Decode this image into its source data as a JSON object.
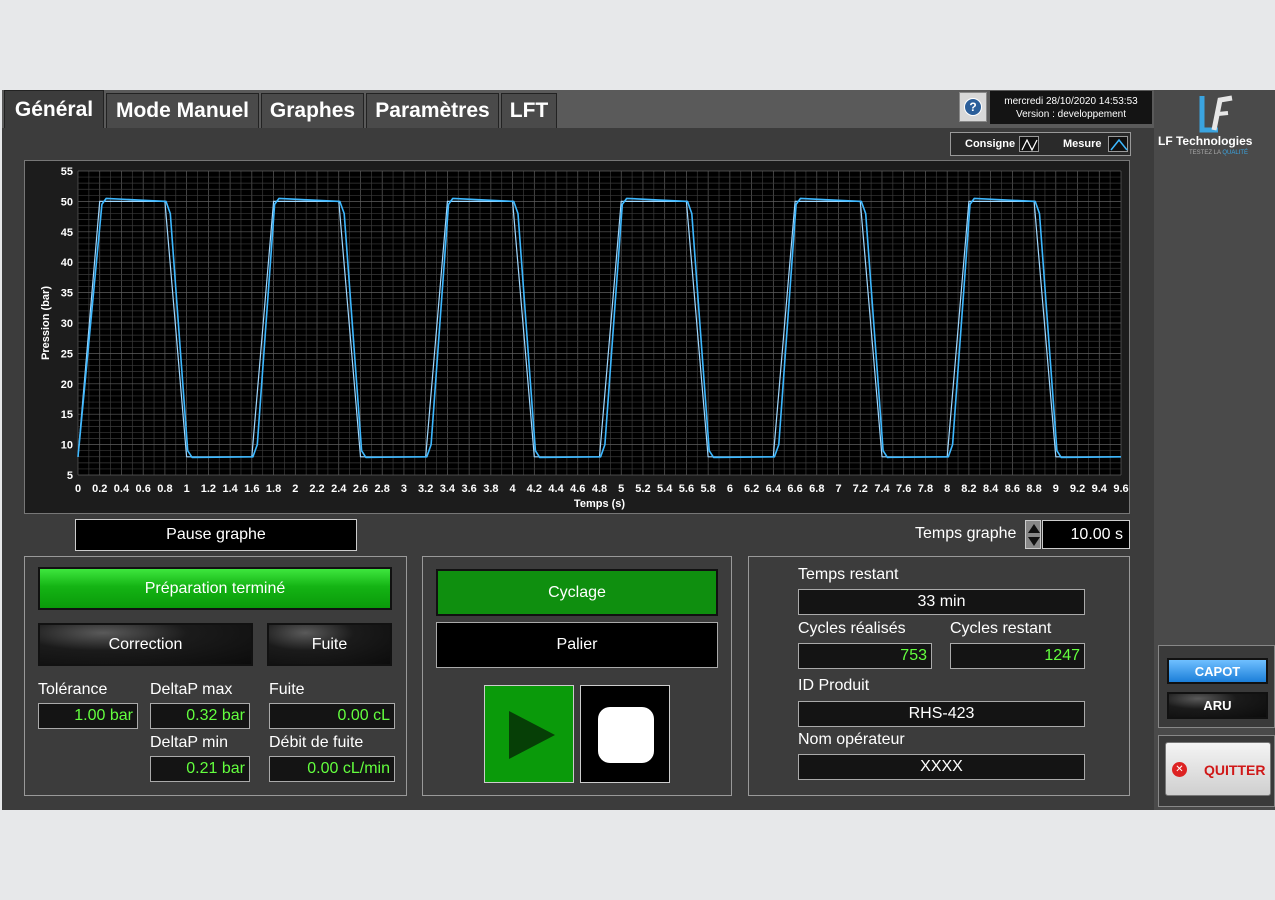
{
  "tabs": [
    {
      "label": "Général",
      "active": true
    },
    {
      "label": "Mode Manuel",
      "active": false
    },
    {
      "label": "Graphes",
      "active": false
    },
    {
      "label": "Paramètres",
      "active": false
    },
    {
      "label": "LFT",
      "active": false
    }
  ],
  "header": {
    "date": "mercredi 28/10/2020 14:53:53",
    "version": "Version : developpement",
    "help_icon": "question-icon"
  },
  "logo": {
    "brand": "LF Technologies",
    "tagline_prefix": "TESTEZ LA ",
    "tagline_highlight": "QUALITÉ"
  },
  "legend": {
    "consigne": "Consigne",
    "mesure": "Mesure"
  },
  "chart_data": {
    "type": "line",
    "xlabel": "Temps (s)",
    "ylabel": "Pression (bar)",
    "xlim": [
      0,
      9.6
    ],
    "ylim": [
      5,
      55
    ],
    "x_ticks": [
      0,
      0.2,
      0.4,
      0.6,
      0.8,
      1,
      1.2,
      1.4,
      1.6,
      1.8,
      2,
      2.2,
      2.4,
      2.6,
      2.8,
      3,
      3.2,
      3.4,
      3.6,
      3.8,
      4,
      4.2,
      4.4,
      4.6,
      4.8,
      5,
      5.2,
      5.4,
      5.6,
      5.8,
      6,
      6.2,
      6.4,
      6.6,
      6.8,
      7,
      7.2,
      7.4,
      7.6,
      7.8,
      8,
      8.2,
      8.4,
      8.6,
      8.8,
      9,
      9.2,
      9.4,
      9.6
    ],
    "y_ticks": [
      5,
      10,
      15,
      20,
      25,
      30,
      35,
      40,
      45,
      50,
      55
    ],
    "grid": true,
    "legend_position": "top-right",
    "series": [
      {
        "name": "Consigne",
        "color": "#9fd8ff",
        "x": [
          0,
          0.2,
          0.8,
          1.0,
          1.6,
          1.8,
          2.4,
          2.6,
          3.2,
          3.4,
          4.0,
          4.2,
          4.8,
          5.0,
          5.6,
          5.8,
          6.4,
          6.6,
          7.2,
          7.4,
          8.0,
          8.2,
          8.8,
          9.0,
          9.6
        ],
        "y": [
          8,
          50,
          50,
          8,
          8,
          50,
          50,
          8,
          8,
          50,
          50,
          8,
          8,
          50,
          50,
          8,
          8,
          50,
          50,
          8,
          8,
          50,
          50,
          8,
          8
        ]
      },
      {
        "name": "Mesure",
        "color": "#3db8ff",
        "x": [
          0,
          0.22,
          0.26,
          0.81,
          0.85,
          1.01,
          1.05,
          1.61,
          1.65,
          1.81,
          1.85,
          2.41,
          2.45,
          2.61,
          2.65,
          3.21,
          3.25,
          3.41,
          3.45,
          4.01,
          4.05,
          4.21,
          4.25,
          4.81,
          4.85,
          5.01,
          5.05,
          5.61,
          5.65,
          5.81,
          5.85,
          6.41,
          6.45,
          6.61,
          6.65,
          7.21,
          7.25,
          7.41,
          7.45,
          8.01,
          8.05,
          8.21,
          8.25,
          8.81,
          8.85,
          9.01,
          9.05,
          9.6
        ],
        "y": [
          8,
          49.5,
          50.5,
          50,
          48,
          9,
          7.9,
          8,
          10,
          49.5,
          50.5,
          50,
          48,
          9,
          7.9,
          8,
          10,
          49.5,
          50.5,
          50,
          48,
          9,
          7.9,
          8,
          10,
          49.5,
          50.5,
          50,
          48,
          9,
          7.9,
          8,
          10,
          49.5,
          50.5,
          50,
          48,
          9,
          7.9,
          8,
          10,
          49.5,
          50.5,
          50,
          48,
          9,
          7.9,
          8
        ]
      }
    ]
  },
  "graph_controls": {
    "pause_label": "Pause graphe",
    "temps_graphe_label": "Temps graphe",
    "temps_graphe_value": "10.00 s"
  },
  "left_panel": {
    "preparation": "Préparation terminé",
    "correction": "Correction",
    "fuite_led": "Fuite",
    "tolerance_label": "Tolérance",
    "tolerance_value": "1.00 bar",
    "deltap_max_label": "DeltaP max",
    "deltap_max_value": "0.32 bar",
    "fuite_label": "Fuite",
    "fuite_value": "0.00 cL",
    "deltap_min_label": "DeltaP min",
    "deltap_min_value": "0.21 bar",
    "debit_label": "Débit de fuite",
    "debit_value": "0.00 cL/min"
  },
  "center_panel": {
    "cyclage": "Cyclage",
    "palier": "Palier",
    "play_icon": "play-icon",
    "stop_icon": "stop-icon"
  },
  "right_info": {
    "temps_restant_label": "Temps restant",
    "temps_restant_value": "33 min",
    "cycles_realises_label": "Cycles réalisés",
    "cycles_realises_value": "753",
    "cycles_restant_label": "Cycles restant",
    "cycles_restant_value": "1247",
    "id_produit_label": "ID Produit",
    "id_produit_value": "RHS-423",
    "nom_operateur_label": "Nom opérateur",
    "nom_operateur_value": "XXXX"
  },
  "side": {
    "capot": "CAPOT",
    "aru": "ARU",
    "quitter": "QUITTER"
  }
}
